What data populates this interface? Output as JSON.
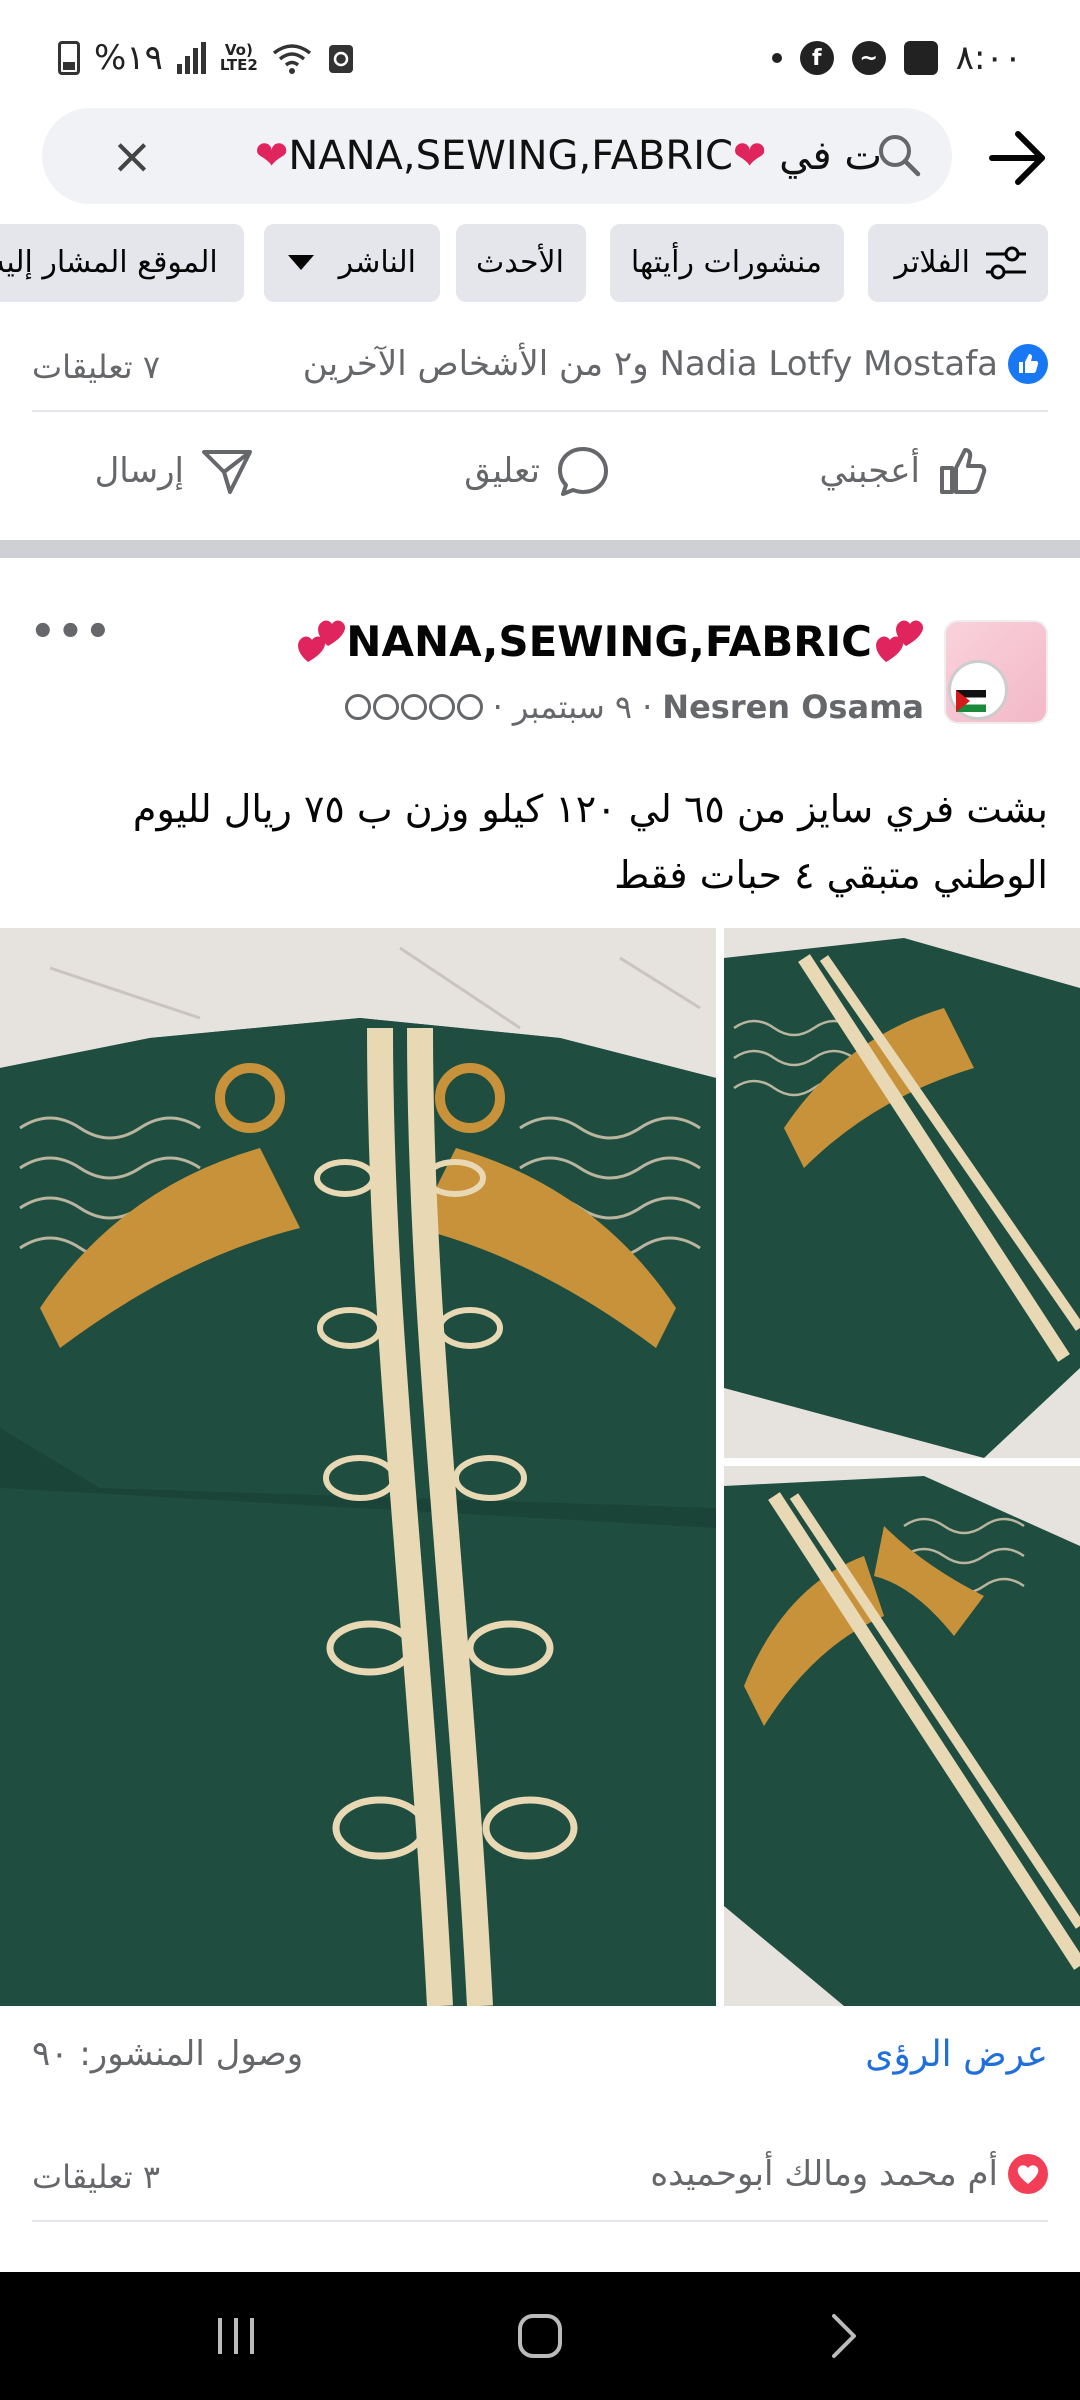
{
  "status_bar": {
    "time": "٨:٠٠",
    "battery": "%١٩",
    "network": "LTE2",
    "volte": "Vo)"
  },
  "search": {
    "query_prefix": "NANA,SEWING,FABRIC",
    "query_suffix": "ت في",
    "icons": [
      "close-icon",
      "search-icon",
      "back-arrow-icon"
    ]
  },
  "filters": [
    {
      "label": "الفلاتر",
      "icon": "sliders-icon"
    },
    {
      "label": "منشورات رأيتها"
    },
    {
      "label": "الأحدث"
    },
    {
      "label": "الناشر",
      "icon": "caret-down-icon"
    },
    {
      "label": "الموقع المشار إليه"
    }
  ],
  "prev_post": {
    "reactions_text": "Nadia Lotfy Mostafa و٢ من الأشخاص الآخرين",
    "comments": "٧ تعليقات",
    "actions": {
      "like": "أعجبني",
      "comment": "تعليق",
      "send": "إرسال"
    }
  },
  "post": {
    "group_name": "NANA,SEWING,FABRIC",
    "author": "Nesren Osama",
    "date": "٩ سبتمبر",
    "separator": "·",
    "text_line1": "بشت فري سايز من ٦٥ لي ١٢٠ كيلو وزن ب ٧٥ ريال لليوم",
    "text_line2": "الوطني متبقي ٤ حبات فقط",
    "reach": "وصول المنشور: ٩٠",
    "insights": "عرض الرؤى",
    "reactions_text": "أم محمد ومالك أبوحميده",
    "comments": "٣ تعليقات",
    "colors": {
      "garment_green": "#1f4e40",
      "embroidery_gold": "#c8923a",
      "embroidery_cream": "#e8d8b4",
      "link_blue": "#216fdb"
    }
  },
  "nav": {
    "buttons": [
      "recent-apps-icon",
      "home-icon",
      "back-icon"
    ]
  }
}
